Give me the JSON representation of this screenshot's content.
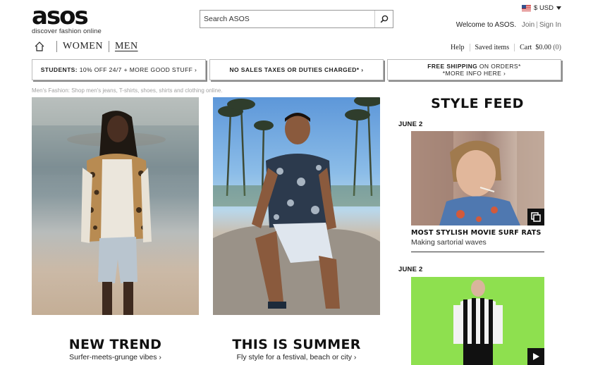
{
  "logo": {
    "word": "asos",
    "tagline": "discover fashion online"
  },
  "search": {
    "placeholder": "Search ASOS",
    "button_icon": "magnifier-icon"
  },
  "currency": {
    "label": "$ USD",
    "flag": "us-flag-icon"
  },
  "account": {
    "welcome": "Welcome to ASOS.",
    "join": "Join",
    "sign_in": "Sign In"
  },
  "nav": {
    "home_icon": "home-icon",
    "women": "WOMEN",
    "men": "MEN",
    "active": "MEN"
  },
  "utility": {
    "help": "Help",
    "saved": "Saved items",
    "cart": "Cart",
    "cart_total": "$0.00",
    "cart_count": "(0)"
  },
  "promos": [
    {
      "bold": "STUDENTS:",
      "text": " 10% OFF 24/7 + MORE GOOD STUFF ›"
    },
    {
      "bold": "",
      "text": "NO SALES TAXES OR DUTIES CHARGED* ›"
    },
    {
      "bold": "FREE SHIPPING",
      "text": " ON ORDERS*",
      "line2": "*MORE INFO HERE ›"
    }
  ],
  "breadcrumb": "Men's Fashion: Shop men's jeans, T-shirts, shoes, shirts and clothing online.",
  "features": [
    {
      "title": "NEW TREND",
      "subtitle": "Surfer-meets-grunge vibes ›"
    },
    {
      "title": "THIS IS SUMMER",
      "subtitle": "Fly style for a festival, beach or city ›"
    }
  ],
  "style_feed": {
    "title": "STYLE FEED",
    "posts": [
      {
        "date": "JUNE 2",
        "title": "MOST STYLISH MOVIE SURF RATS",
        "subtitle": "Making sartorial waves",
        "badge_icon": "gallery-icon"
      },
      {
        "date": "JUNE 2",
        "badge_icon": "play-icon"
      }
    ]
  },
  "colors": {
    "feed_green": "#8ee04f",
    "text": "#111111",
    "muted": "#a0a0a0"
  }
}
